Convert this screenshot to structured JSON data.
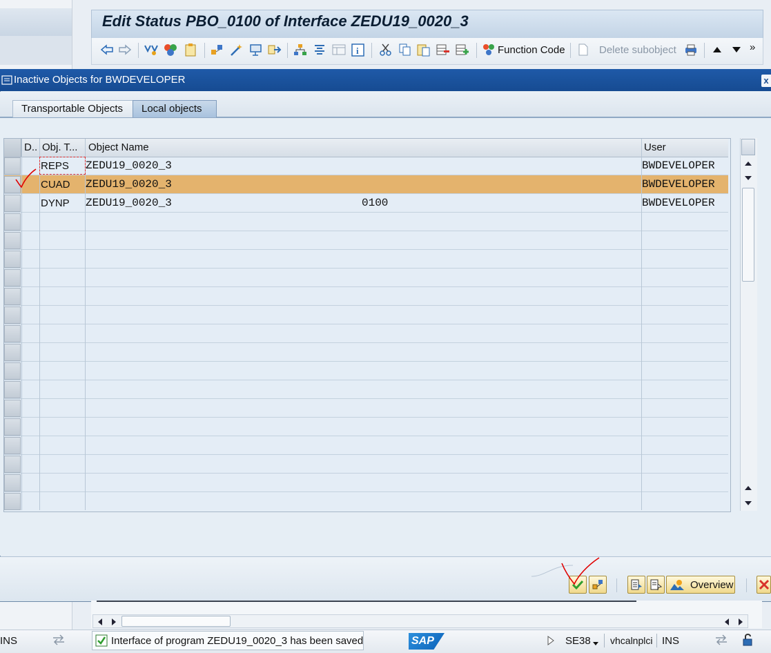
{
  "main_window": {
    "title": "Edit Status PBO_0100 of Interface ZEDU19_0020_3",
    "toolbar": {
      "function_code_label": "Function Code",
      "delete_subobject_label": "Delete subobject",
      "more_label": "»"
    }
  },
  "dialog": {
    "title": "Inactive Objects for BWDEVELOPER",
    "close_label": "x",
    "tabs": [
      {
        "label": "Transportable Objects",
        "active": false
      },
      {
        "label": "Local objects",
        "active": true
      }
    ],
    "table": {
      "columns": [
        "D..",
        "Obj. T...",
        "Object Name",
        "User"
      ],
      "rows": [
        {
          "obj_type": "REPS",
          "object_name": "ZEDU19_0020_3",
          "sub_name": "",
          "user": "BWDEVELOPER",
          "selected": false
        },
        {
          "obj_type": "CUAD",
          "object_name": "ZEDU19_0020_3",
          "sub_name": "",
          "user": "BWDEVELOPER",
          "selected": true
        },
        {
          "obj_type": "DYNP",
          "object_name": "ZEDU19_0020_3",
          "sub_name": "0100",
          "user": "BWDEVELOPER",
          "selected": false
        }
      ]
    },
    "footer": {
      "overview_label": "Overview"
    }
  },
  "status_bar": {
    "left_mode": "INS",
    "message": "Interface of program ZEDU19_0020_3 has been saved",
    "logo": "SAP",
    "transaction": "SE38",
    "server": "vhcalnplci",
    "mode": "INS"
  },
  "colors": {
    "selected_row": "#e4b36d",
    "titlebar": "#1f5aa8",
    "annotation": "#e00000"
  }
}
